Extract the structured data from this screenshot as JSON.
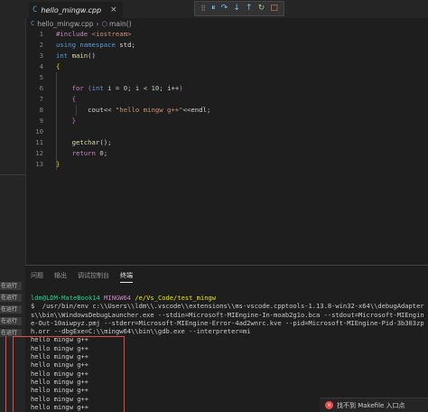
{
  "window": {
    "tab": {
      "icon": "C",
      "label": "hello_mingw.cpp",
      "close": "×"
    },
    "breadcrumb": {
      "file": "hello_mingw.cpp",
      "separator": "›",
      "symbol": "main()"
    }
  },
  "debug_toolbar": {
    "icons": [
      "drag-grip-icon",
      "pause-icon",
      "step-over-icon",
      "step-into-icon",
      "step-out-icon",
      "restart-icon",
      "stop-icon"
    ],
    "glyphs": {
      "grip": "⠿",
      "pause": "⏸",
      "step_over": "↷",
      "step_into": "↓",
      "step_out": "↑",
      "restart": "↻",
      "stop": "□"
    }
  },
  "editor": {
    "lines": [
      {
        "n": "1",
        "tokens": [
          [
            "pre",
            "#include "
          ],
          [
            "inc",
            "<iostream>"
          ]
        ]
      },
      {
        "n": "2",
        "tokens": [
          [
            "kw",
            "using namespace "
          ],
          [
            "plain",
            "std;"
          ]
        ]
      },
      {
        "n": "3",
        "tokens": [
          [
            "kw",
            "int "
          ],
          [
            "fn",
            "main"
          ],
          [
            "plain",
            "()"
          ]
        ]
      },
      {
        "n": "4",
        "tokens": [
          [
            "brace",
            "{"
          ]
        ]
      },
      {
        "n": "5",
        "tokens": []
      },
      {
        "n": "6",
        "tokens": [
          [
            "plain",
            "    "
          ],
          [
            "pre",
            "for "
          ],
          [
            "brace2",
            "("
          ],
          [
            "kw",
            "int "
          ],
          [
            "plain",
            "i = "
          ],
          [
            "num",
            "0"
          ],
          [
            "plain",
            "; i < "
          ],
          [
            "num",
            "10"
          ],
          [
            "plain",
            "; i++"
          ],
          [
            "brace2",
            ")"
          ]
        ]
      },
      {
        "n": "7",
        "tokens": [
          [
            "plain",
            "    "
          ],
          [
            "brace2",
            "{"
          ]
        ]
      },
      {
        "n": "8",
        "tokens": [
          [
            "plain",
            "        cout<< "
          ],
          [
            "str",
            "\"hello mingw g++\""
          ],
          [
            "plain",
            "<<endl;"
          ]
        ]
      },
      {
        "n": "9",
        "tokens": [
          [
            "plain",
            "    "
          ],
          [
            "brace2",
            "}"
          ]
        ]
      },
      {
        "n": "10",
        "tokens": []
      },
      {
        "n": "11",
        "tokens": [
          [
            "plain",
            "    "
          ],
          [
            "fn",
            "getchar"
          ],
          [
            "plain",
            "();"
          ]
        ]
      },
      {
        "n": "12",
        "tokens": [
          [
            "plain",
            "    "
          ],
          [
            "pre",
            "return "
          ],
          [
            "num",
            "0"
          ],
          [
            "plain",
            ";"
          ]
        ]
      },
      {
        "n": "13",
        "tokens": [
          [
            "brace",
            "}"
          ]
        ]
      }
    ]
  },
  "panel": {
    "tabs": [
      "问题",
      "输出",
      "调试控制台",
      "终端"
    ],
    "active_tab": 3
  },
  "terminal": {
    "prompt_user": "ldm@LDM-MateBook14",
    "prompt_host": "MINGW64",
    "prompt_path": "/e/Vs_Code/test_mingw",
    "command": "$  /usr/bin/env c:\\\\Users\\\\ldm\\\\.vscode\\\\extensions\\\\ms-vscode.cpptools-1.13.8-win32-x64\\\\debugAdapters\\\\bin\\\\WindowsDebugLauncher.exe --stdin=Microsoft-MIEngine-In-moab2g1o.bca --stdout=Microsoft-MIEngine-Out-10aiwpyz.pmj --stderr=Microsoft-MIEngine-Error-4ad2wnrc.kve --pid=Microsoft-MIEngine-Pid-3b303zph.orr --dbgExe=C:\\\\mingw64\\\\bin\\\\gdb.exe --interpreter=mi",
    "output": [
      "hello mingw g++",
      "hello mingw g++",
      "hello mingw g++",
      "hello mingw g++",
      "hello mingw g++",
      "hello mingw g++",
      "hello mingw g++",
      "hello mingw g++",
      "hello mingw g++"
    ]
  },
  "left_strip": {
    "badges": [
      "在运行",
      "在运行",
      "在运行",
      "在运行",
      "在运行"
    ]
  },
  "notification": {
    "icon": "×",
    "text": "找不到 Makefile 入口点"
  },
  "colors": {
    "editor_bg": "#1e1e1e",
    "keyword": "#569cd6",
    "function": "#dcdcaa",
    "string": "#ce9178",
    "number": "#b5cea8",
    "preprocessor": "#c586c0",
    "prompt_user": "#23d18b",
    "prompt_path": "#e5e510",
    "selection_outline": "#e2474b"
  }
}
